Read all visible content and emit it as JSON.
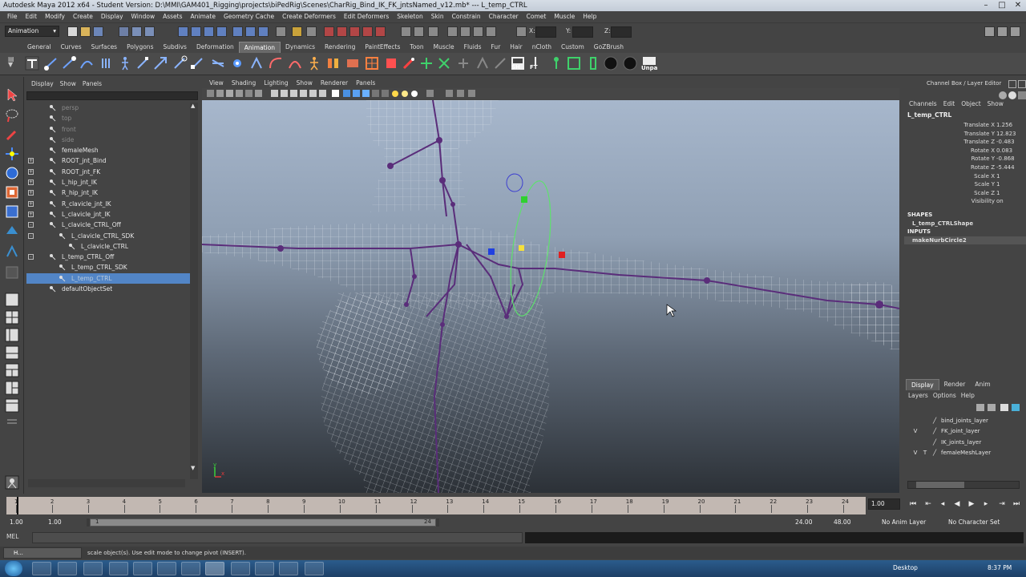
{
  "title": "Autodesk Maya 2012 x64 - Student Version: D:\\MMI\\GAM401_Rigging\\projects\\biPedRig\\Scenes\\CharRig_Bind_IK_FK_jntsNamed_v12.mb*   ---   L_temp_CTRL",
  "menubar": [
    "File",
    "Edit",
    "Modify",
    "Create",
    "Display",
    "Window",
    "Assets",
    "Animate",
    "Geometry Cache",
    "Create Deformers",
    "Edit Deformers",
    "Skeleton",
    "Skin",
    "Constrain",
    "Character",
    "Comet",
    "Muscle",
    "Help"
  ],
  "status": {
    "menuset": "Animation",
    "x_label": "X:",
    "y_label": "Y:",
    "z_label": "Z:"
  },
  "shelf_tabs": [
    "General",
    "Curves",
    "Surfaces",
    "Polygons",
    "Subdivs",
    "Deformation",
    "Animation",
    "Dynamics",
    "Rendering",
    "PaintEffects",
    "Toon",
    "Muscle",
    "Fluids",
    "Fur",
    "Hair",
    "nCloth",
    "Custom",
    "GoZBrush"
  ],
  "shelf_active": "Animation",
  "shelf_labels": {
    "sh": "SH",
    "ft": "FT",
    "unpa": "Unpa"
  },
  "outliner": {
    "menu": [
      "Display",
      "Show",
      "Panels"
    ],
    "items": [
      {
        "label": "persp",
        "dim": true,
        "indent": 0,
        "exp": ""
      },
      {
        "label": "top",
        "dim": true,
        "indent": 0,
        "exp": ""
      },
      {
        "label": "front",
        "dim": true,
        "indent": 0,
        "exp": ""
      },
      {
        "label": "side",
        "dim": true,
        "indent": 0,
        "exp": ""
      },
      {
        "label": "femaleMesh",
        "dim": false,
        "indent": 0,
        "exp": ""
      },
      {
        "label": "ROOT_jnt_Bind",
        "dim": false,
        "indent": 0,
        "exp": "+"
      },
      {
        "label": "ROOT_jnt_FK",
        "dim": false,
        "indent": 0,
        "exp": "+"
      },
      {
        "label": "L_hip_jnt_IK",
        "dim": false,
        "indent": 0,
        "exp": "+"
      },
      {
        "label": "R_hip_jnt_IK",
        "dim": false,
        "indent": 0,
        "exp": "+"
      },
      {
        "label": "R_clavicle_jnt_IK",
        "dim": false,
        "indent": 0,
        "exp": "+"
      },
      {
        "label": "L_clavicle_jnt_IK",
        "dim": false,
        "indent": 0,
        "exp": "+"
      },
      {
        "label": "L_clavicle_CTRL_Off",
        "dim": false,
        "indent": 0,
        "exp": "-"
      },
      {
        "label": "L_clavicle_CTRL_SDK",
        "dim": false,
        "indent": 1,
        "exp": "-"
      },
      {
        "label": "L_clavicle_CTRL",
        "dim": false,
        "indent": 2,
        "exp": ""
      },
      {
        "label": "L_temp_CTRL_Off",
        "dim": false,
        "indent": 0,
        "exp": "-"
      },
      {
        "label": "L_temp_CTRL_SDK",
        "dim": false,
        "indent": 1,
        "exp": ""
      },
      {
        "label": "L_temp_CTRL",
        "dim": false,
        "indent": 1,
        "exp": "",
        "selected": true
      },
      {
        "label": "defaultObjectSet",
        "dim": false,
        "indent": 0,
        "exp": ""
      }
    ]
  },
  "viewport": {
    "menu": [
      "View",
      "Shading",
      "Lighting",
      "Show",
      "Renderer",
      "Panels"
    ],
    "axis_x": "x",
    "axis_y": "y"
  },
  "channelbox": {
    "title": "Channel Box / Layer Editor",
    "menu": [
      "Channels",
      "Edit",
      "Object",
      "Show"
    ],
    "node": "L_temp_CTRL",
    "channels": [
      {
        "name": "Translate X",
        "value": "1.256"
      },
      {
        "name": "Translate Y",
        "value": "12.823"
      },
      {
        "name": "Translate Z",
        "value": "-0.483"
      },
      {
        "name": "Rotate X",
        "value": "0.083"
      },
      {
        "name": "Rotate Y",
        "value": "-0.868"
      },
      {
        "name": "Rotate Z",
        "value": "-5.444"
      },
      {
        "name": "Scale X",
        "value": "1"
      },
      {
        "name": "Scale Y",
        "value": "1"
      },
      {
        "name": "Scale Z",
        "value": "1"
      },
      {
        "name": "Visibility",
        "value": "on"
      }
    ],
    "shapes_label": "SHAPES",
    "shape": "L_temp_CTRLShape",
    "inputs_label": "INPUTS",
    "input": "makeNurbCircle2"
  },
  "layereditor": {
    "tabs": [
      "Display",
      "Render",
      "Anim"
    ],
    "menu": [
      "Layers",
      "Options",
      "Help"
    ],
    "layers": [
      {
        "name": "bind_joints_layer",
        "v": "",
        "t": ""
      },
      {
        "name": "FK_joint_layer",
        "v": "V",
        "t": ""
      },
      {
        "name": "IK_joints_layer",
        "v": "",
        "t": ""
      },
      {
        "name": "femaleMeshLayer",
        "v": "V",
        "t": "T"
      }
    ]
  },
  "timeslider": {
    "ticks": [
      "1",
      "2",
      "3",
      "4",
      "5",
      "6",
      "7",
      "8",
      "9",
      "10",
      "11",
      "12",
      "13",
      "14",
      "15",
      "16",
      "17",
      "18",
      "19",
      "20",
      "21",
      "22",
      "23",
      "24"
    ],
    "current_frame": "1.00"
  },
  "rangeslider": {
    "start": "1.00",
    "start2": "1.00",
    "range_start": "1",
    "range_end": "24",
    "end": "24.00",
    "end2": "48.00",
    "anim_layer": "No Anim Layer",
    "char_set": "No Character Set"
  },
  "cmdline": {
    "label": "MEL"
  },
  "helpline": {
    "text": "scale object(s). Use edit mode to change pivot (INSERT).",
    "window": "H..."
  },
  "taskbar": {
    "desktop": "Desktop",
    "clock": "8:37 PM"
  },
  "colors": {
    "viewport_top": "#a7b7cc",
    "viewport_bottom": "#2c3137",
    "selection": "#5285c6",
    "joint": "#6b3f8c"
  }
}
